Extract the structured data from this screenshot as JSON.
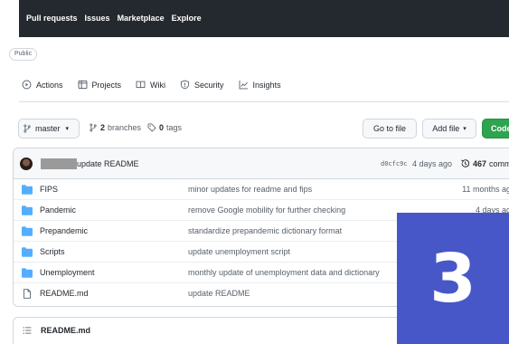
{
  "topnav": {
    "items": [
      "Pull requests",
      "Issues",
      "Marketplace",
      "Explore"
    ]
  },
  "repo": {
    "visibility": "Public",
    "tabs": [
      {
        "label": "Actions",
        "icon": "play-circle-icon"
      },
      {
        "label": "Projects",
        "icon": "project-table-icon"
      },
      {
        "label": "Wiki",
        "icon": "book-icon"
      },
      {
        "label": "Security",
        "icon": "shield-icon"
      },
      {
        "label": "Insights",
        "icon": "graph-icon"
      }
    ]
  },
  "branch_bar": {
    "branch": "master",
    "branch_count": "2",
    "branch_label": "branches",
    "tag_count": "0",
    "tag_label": "tags",
    "goto_file": "Go to file",
    "add_file": "Add file",
    "code": "Code"
  },
  "latest_commit": {
    "message": "update README",
    "sha": "d0cfc9c",
    "age": "4 days ago",
    "count": "467",
    "count_label": "comm"
  },
  "files": [
    {
      "type": "folder",
      "name": "FIPS",
      "message": "minor updates for readme and fips",
      "age": "11 months ag"
    },
    {
      "type": "folder",
      "name": "Pandemic",
      "message": "remove Google mobility for further checking",
      "age": "4 days ag"
    },
    {
      "type": "folder",
      "name": "Prepandemic",
      "message": "standardize prepandemic dictionary format",
      "age": ""
    },
    {
      "type": "folder",
      "name": "Scripts",
      "message": "update unemployment script",
      "age": ""
    },
    {
      "type": "folder",
      "name": "Unemployment",
      "message": "monthly update of unemployment data and dictionary",
      "age": ""
    },
    {
      "type": "file",
      "name": "README.md",
      "message": "update README",
      "age": ""
    }
  ],
  "readme": {
    "title": "README.md"
  },
  "overlay": {
    "label": "3",
    "color": "#4757c7"
  },
  "colors": {
    "header_bg": "#24292f",
    "folder": "#54aeff",
    "code_button": "#2da44e"
  }
}
